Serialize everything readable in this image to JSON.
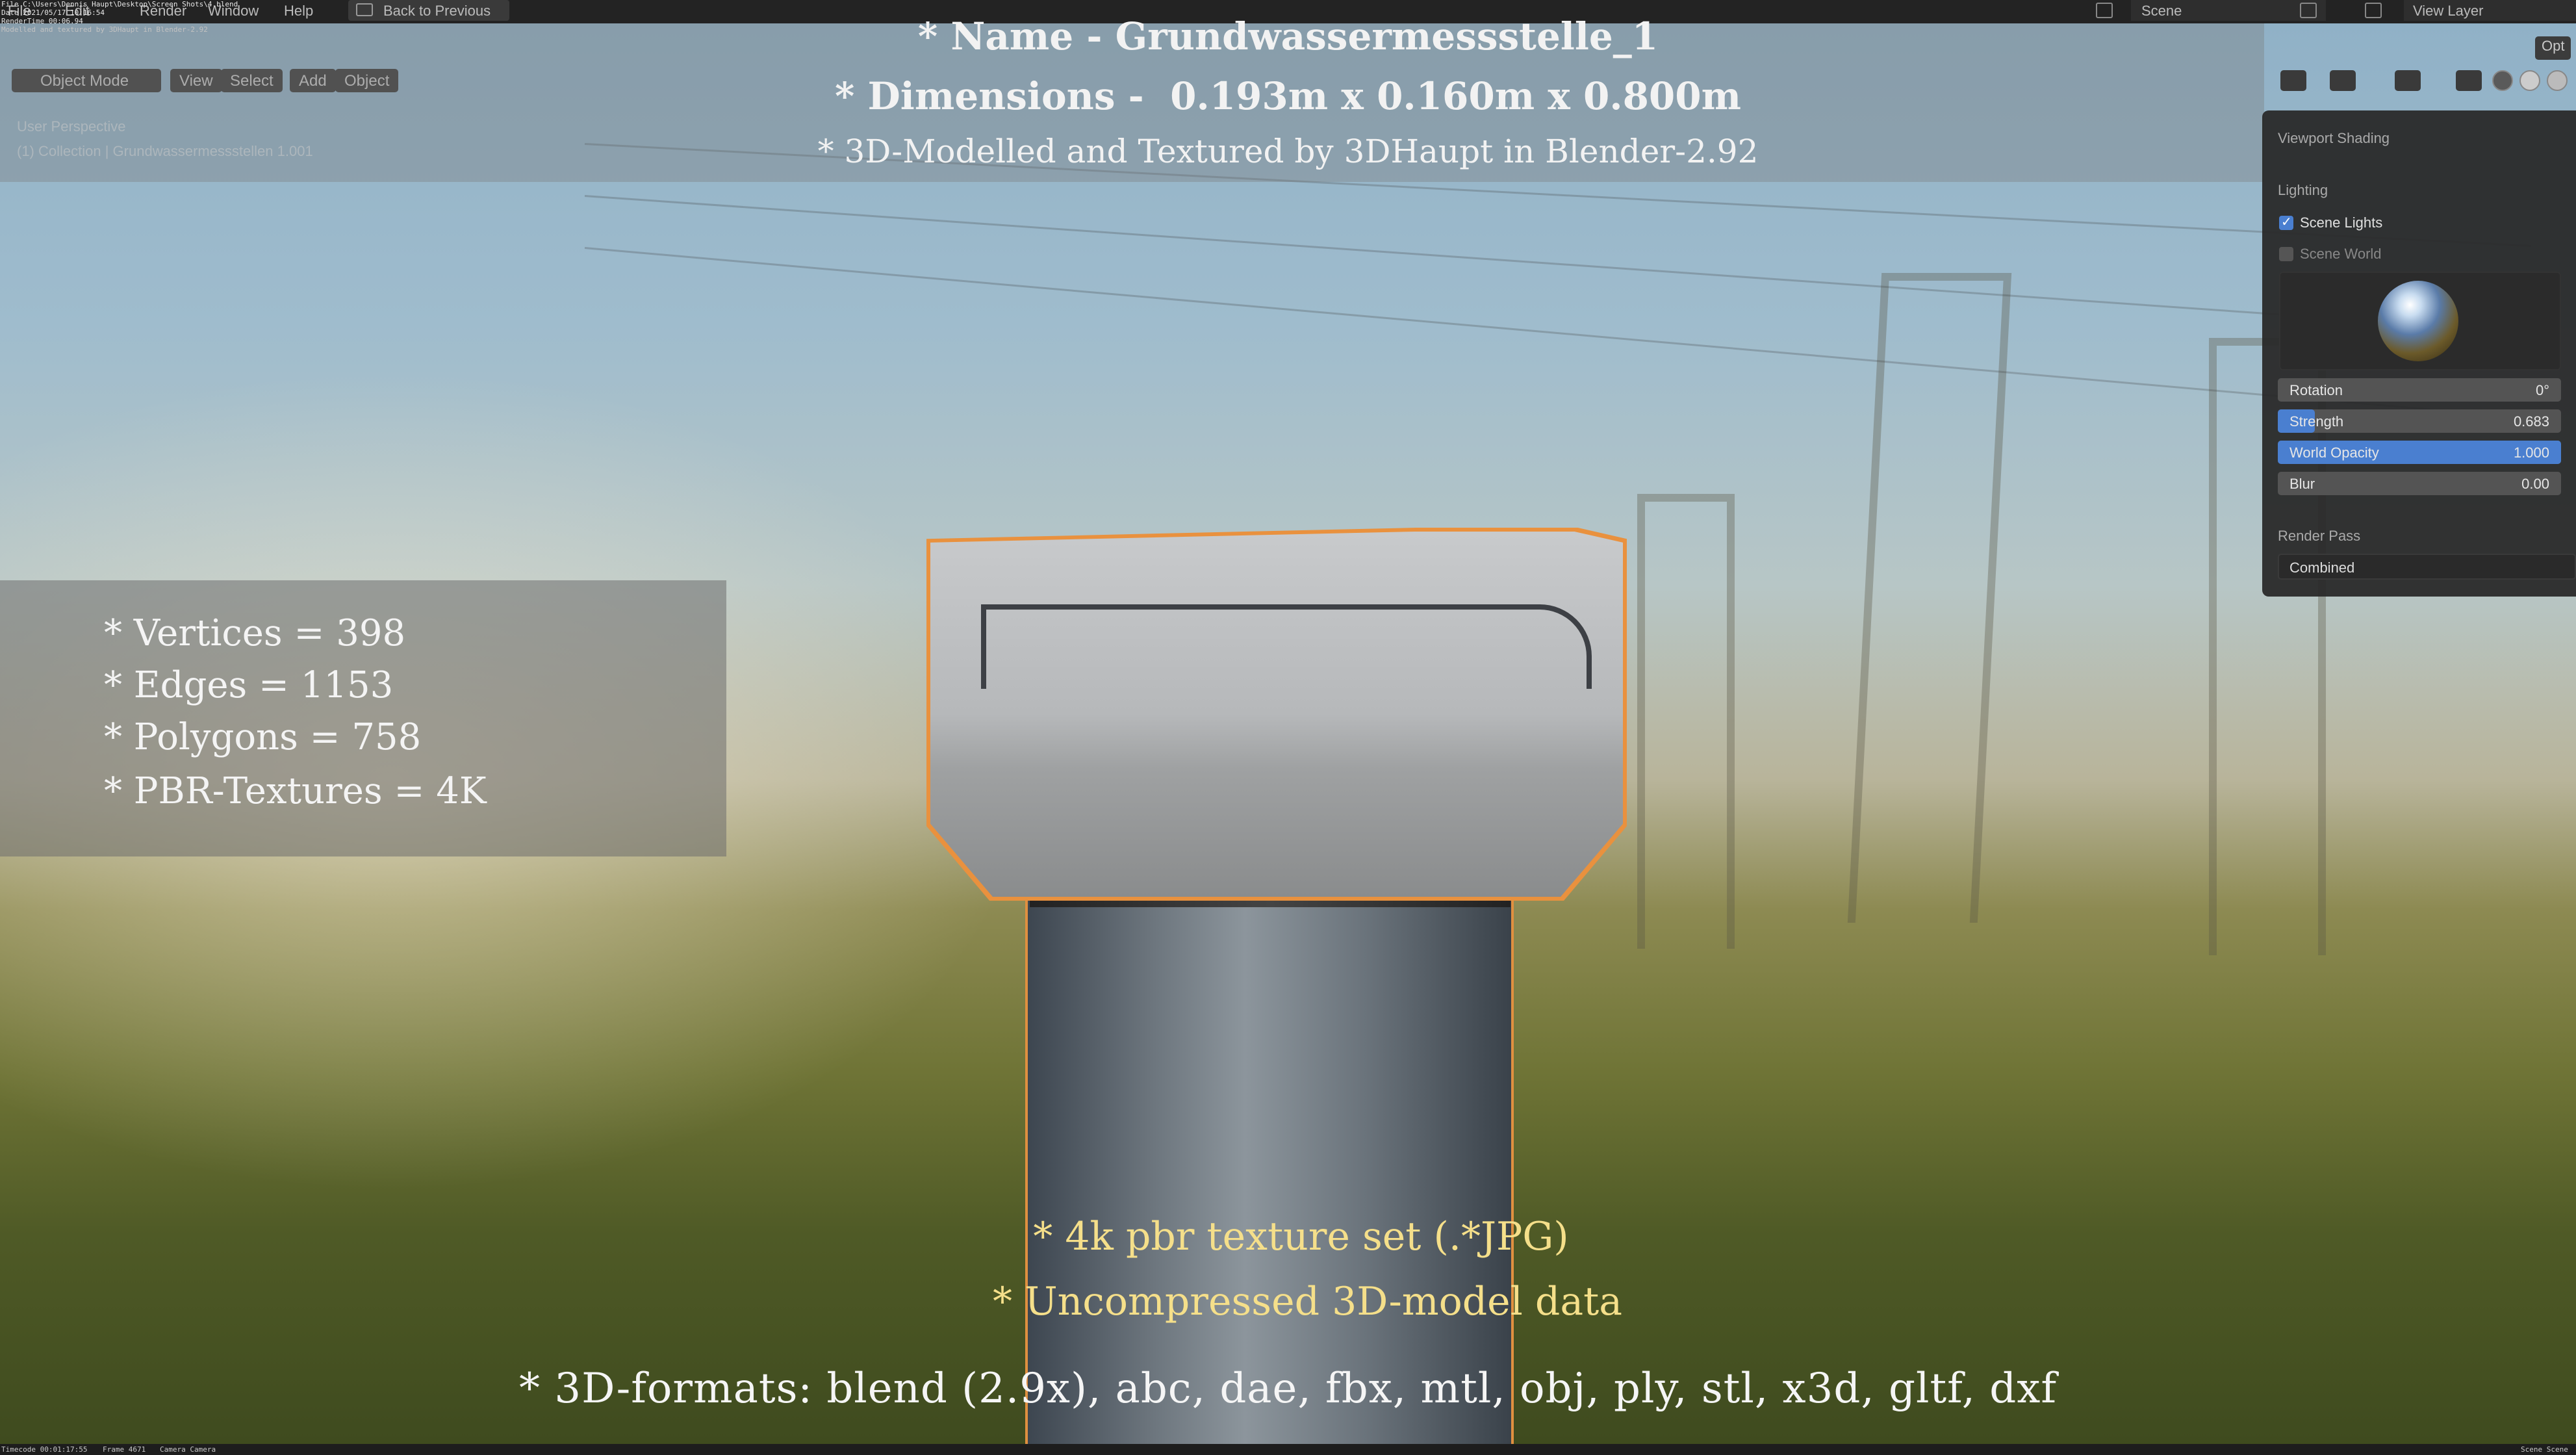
{
  "topbar": {
    "menu": [
      "File",
      "Edit",
      "Render",
      "Window",
      "Help"
    ],
    "back_label": "Back to Previous",
    "scene_label": "Scene",
    "view_layer_label": "View Layer"
  },
  "render_stamp": [
    "File C:\\Users\\Dennis Haupt\\Desktop\\Screen Shots\\4.blend",
    "Date 2021/05/17 10:16:54",
    "RenderTime 00:06.94",
    "Modelled and textured by 3DHaupt in Blender-2.92"
  ],
  "viewport": {
    "mode_label": "Object Mode",
    "menus": [
      "View",
      "Select",
      "Add",
      "Object"
    ],
    "perspective": "User Perspective",
    "collection": "(1) Collection | Grundwassermessstellen 1.001",
    "options_label": "Opt"
  },
  "banner": {
    "name_line": "* Name - Grundwassermessstelle_1",
    "dimensions_line": "* Dimensions -  0.193m x 0.160m x 0.800m",
    "credit_line": "* 3D-Modelled and Textured by 3DHaupt in Blender-2.92"
  },
  "stats": [
    "* Vertices = 398",
    "* Edges = 1153",
    "* Polygons = 758",
    "* PBR-Textures = 4K"
  ],
  "bottom": {
    "textures_line": "* 4k pbr texture set (.*JPG)",
    "data_line": "* Uncompressed 3D-model data",
    "formats_line": "* 3D-formats: blend (2.9x), abc, dae, fbx, mtl, obj, ply, stl, x3d, gltf, dxf",
    "highlight_color": "#f5df8a"
  },
  "shading_panel": {
    "title": "Viewport Shading",
    "lighting_label": "Lighting",
    "scene_lights": {
      "label": "Scene Lights",
      "checked": true
    },
    "scene_world": {
      "label": "Scene World",
      "checked": false
    },
    "rotation": {
      "label": "Rotation",
      "value": "0°"
    },
    "strength": {
      "label": "Strength",
      "value": "0.683",
      "fill": 0.13
    },
    "world_opacity": {
      "label": "World Opacity",
      "value": "1.000",
      "fill": 1.0
    },
    "blur": {
      "label": "Blur",
      "value": "0.00"
    },
    "render_pass_label": "Render Pass",
    "render_pass_value": "Combined",
    "accent": "#4a7fd0"
  },
  "statusbar": {
    "timecode": "Timecode 00:01:17:55",
    "frame": "Frame 4671",
    "camera": "Camera Camera",
    "scene": "Scene Scene"
  }
}
